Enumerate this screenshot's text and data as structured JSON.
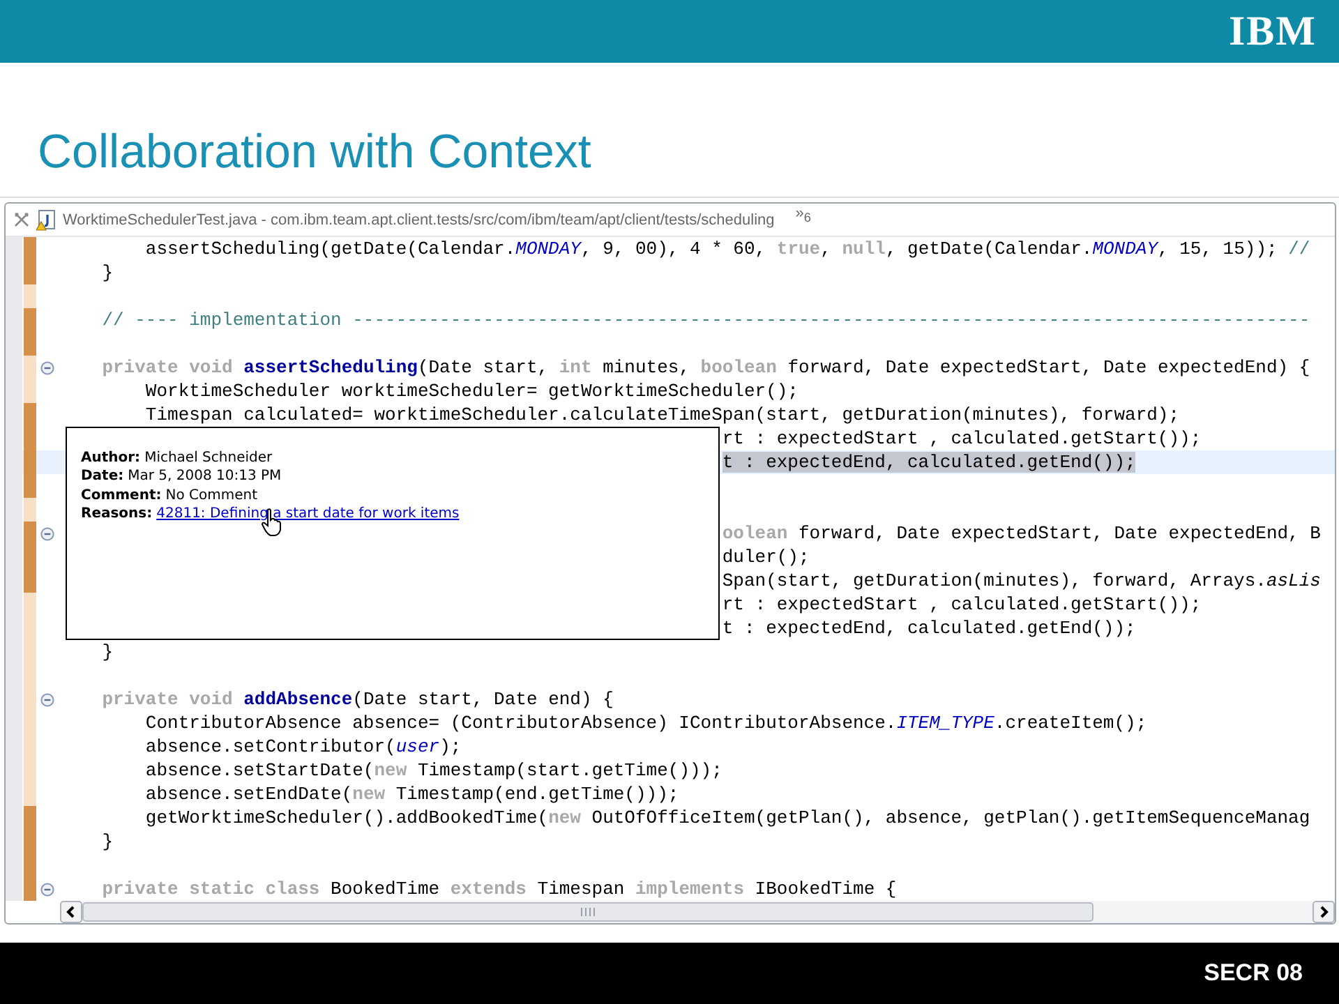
{
  "header": {
    "logo": "IBM"
  },
  "slide_title": "Collaboration with Context",
  "editor": {
    "tab": {
      "title": "WorktimeSchedulerTest.java - com.ibm.team.apt.client.tests/src/com/ibm/team/apt/client/tests/scheduling",
      "overflow": "»$_{6}$"
    },
    "lines": [
      {
        "kind": "code",
        "recent": true,
        "fold": false,
        "current": false,
        "segments": [
          {
            "text": "        assertScheduling(getDate(Calendar.",
            "kind": "plain"
          },
          {
            "text": "MONDAY",
            "kind": "constant"
          },
          {
            "text": ", 9, 00), 4 * 60, ",
            "kind": "plain"
          },
          {
            "text": "true",
            "kind": "keyword"
          },
          {
            "text": ", ",
            "kind": "plain"
          },
          {
            "text": "null",
            "kind": "keyword"
          },
          {
            "text": ", getDate(Calendar.",
            "kind": "plain"
          },
          {
            "text": "MONDAY",
            "kind": "constant"
          },
          {
            "text": ", 15, 15)); ",
            "kind": "plain"
          },
          {
            "text": "//",
            "kind": "comment"
          }
        ]
      },
      {
        "kind": "code",
        "recent": true,
        "fold": false,
        "current": false,
        "segments": [
          {
            "text": "    }",
            "kind": "plain"
          }
        ]
      },
      {
        "recent": false,
        "fold": false,
        "current": false
      },
      {
        "kind": "code",
        "recent": true,
        "fold": false,
        "current": false,
        "segments": [
          {
            "text": "    // ---- implementation ----------------------------------------------------------------------------------------",
            "kind": "comment"
          }
        ]
      },
      {
        "recent": true,
        "fold": false,
        "current": false
      },
      {
        "kind": "code",
        "recent": false,
        "fold": true,
        "current": false,
        "segments": [
          {
            "text": "    private void ",
            "kind": "keyword"
          },
          {
            "text": "assertScheduling",
            "kind": "method"
          },
          {
            "text": "(Date start, ",
            "kind": "plain"
          },
          {
            "text": "int",
            "kind": "keyword"
          },
          {
            "text": " minutes, ",
            "kind": "plain"
          },
          {
            "text": "boolean",
            "kind": "keyword"
          },
          {
            "text": " forward, Date expectedStart, Date expectedEnd) {",
            "kind": "plain"
          }
        ]
      },
      {
        "kind": "code",
        "recent": false,
        "fold": false,
        "current": false,
        "segments": [
          {
            "text": "        WorktimeScheduler worktimeScheduler= getWorktimeScheduler();",
            "kind": "plain"
          }
        ]
      },
      {
        "kind": "code",
        "recent": true,
        "fold": false,
        "current": false,
        "segments": [
          {
            "text": "        Timespan calculated= worktimeScheduler.calculateTimeSpan(start, getDuration(minutes), forward);",
            "kind": "plain"
          }
        ]
      },
      {
        "kind": "after-popup",
        "recent": true,
        "fold": false,
        "current": false,
        "segments": [
          {
            "text": "rt : expectedStart , calculated.getStart());",
            "kind": "plain"
          }
        ]
      },
      {
        "kind": "after-popup",
        "recent": true,
        "fold": false,
        "current": true,
        "segments": [
          {
            "text": "t : expectedEnd, calculated.getEnd());",
            "kind": "plain"
          }
        ]
      },
      {
        "recent": true,
        "fold": false,
        "current": false
      },
      {
        "recent": false,
        "fold": false,
        "current": false
      },
      {
        "kind": "after-popup",
        "recent": true,
        "fold": true,
        "current": false,
        "segments": [
          {
            "text": "oolean",
            "kind": "keyword"
          },
          {
            "text": " forward, Date expectedStart, Date expectedEnd, B",
            "kind": "plain"
          }
        ]
      },
      {
        "kind": "after-popup",
        "recent": true,
        "fold": false,
        "current": false,
        "segments": [
          {
            "text": "duler();",
            "kind": "plain"
          }
        ]
      },
      {
        "kind": "after-popup",
        "recent": true,
        "fold": false,
        "current": false,
        "segments": [
          {
            "text": "Span(start, getDuration(minutes), forward, Arrays.",
            "kind": "plain"
          },
          {
            "text": "asLis",
            "kind": "static"
          }
        ]
      },
      {
        "kind": "after-popup",
        "recent": false,
        "fold": false,
        "current": false,
        "segments": [
          {
            "text": "rt : expectedStart , calculated.getStart());",
            "kind": "plain"
          }
        ]
      },
      {
        "kind": "after-popup",
        "recent": false,
        "fold": false,
        "current": false,
        "segments": [
          {
            "text": "t : expectedEnd, calculated.getEnd());",
            "kind": "plain"
          }
        ]
      },
      {
        "kind": "code",
        "recent": false,
        "fold": false,
        "current": false,
        "segments": [
          {
            "text": "    }",
            "kind": "plain"
          }
        ]
      },
      {
        "recent": false,
        "fold": false,
        "current": false
      },
      {
        "kind": "code",
        "recent": false,
        "fold": true,
        "current": false,
        "segments": [
          {
            "text": "    private void ",
            "kind": "keyword"
          },
          {
            "text": "addAbsence",
            "kind": "method"
          },
          {
            "text": "(Date start, Date end) {",
            "kind": "plain"
          }
        ]
      },
      {
        "kind": "code",
        "recent": false,
        "fold": false,
        "current": false,
        "segments": [
          {
            "text": "        ContributorAbsence absence= (ContributorAbsence) IContributorAbsence.",
            "kind": "plain"
          },
          {
            "text": "ITEM_TYPE",
            "kind": "constant"
          },
          {
            "text": ".createItem();",
            "kind": "plain"
          }
        ]
      },
      {
        "kind": "code",
        "recent": false,
        "fold": false,
        "current": false,
        "segments": [
          {
            "text": "        absence.setContributor(",
            "kind": "plain"
          },
          {
            "text": "user",
            "kind": "constant"
          },
          {
            "text": ");",
            "kind": "plain"
          }
        ]
      },
      {
        "kind": "code",
        "recent": false,
        "fold": false,
        "current": false,
        "segments": [
          {
            "text": "        absence.setStartDate(",
            "kind": "plain"
          },
          {
            "text": "new",
            "kind": "keyword"
          },
          {
            "text": " Timestamp(start.getTime()));",
            "kind": "plain"
          }
        ]
      },
      {
        "kind": "code",
        "recent": false,
        "fold": false,
        "current": false,
        "segments": [
          {
            "text": "        absence.setEndDate(",
            "kind": "plain"
          },
          {
            "text": "new",
            "kind": "keyword"
          },
          {
            "text": " Timestamp(end.getTime()));",
            "kind": "plain"
          }
        ]
      },
      {
        "kind": "code",
        "recent": true,
        "fold": false,
        "current": false,
        "segments": [
          {
            "text": "        getWorktimeScheduler().addBookedTime(",
            "kind": "plain"
          },
          {
            "text": "new",
            "kind": "keyword"
          },
          {
            "text": " OutOfOfficeItem(getPlan(), absence, getPlan().getItemSequenceManag",
            "kind": "plain"
          }
        ]
      },
      {
        "kind": "code",
        "recent": true,
        "fold": false,
        "current": false,
        "segments": [
          {
            "text": "    }",
            "kind": "plain"
          }
        ]
      },
      {
        "recent": true,
        "fold": false,
        "current": false
      },
      {
        "kind": "code",
        "recent": true,
        "fold": true,
        "current": false,
        "segments": [
          {
            "text": "    private static class",
            "kind": "keyword"
          },
          {
            "text": " BookedTime ",
            "kind": "plain"
          },
          {
            "text": "extends",
            "kind": "keyword"
          },
          {
            "text": " Timespan ",
            "kind": "plain"
          },
          {
            "text": "implements",
            "kind": "keyword"
          },
          {
            "text": " IBookedTime {",
            "kind": "plain"
          }
        ]
      }
    ],
    "hover": {
      "fields": [
        {
          "label": "Author:",
          "value": "Michael Schneider",
          "kind": "text"
        },
        {
          "label": "Date:",
          "value": "Mar 5, 2008 10:13 PM",
          "kind": "text"
        },
        {
          "label": "Comment:",
          "value": "No Comment",
          "kind": "text"
        },
        {
          "label": "Reasons:",
          "value": "42811: Defining a start date for work items",
          "kind": "link"
        }
      ]
    }
  },
  "footer": {
    "label": "SECR 08"
  }
}
